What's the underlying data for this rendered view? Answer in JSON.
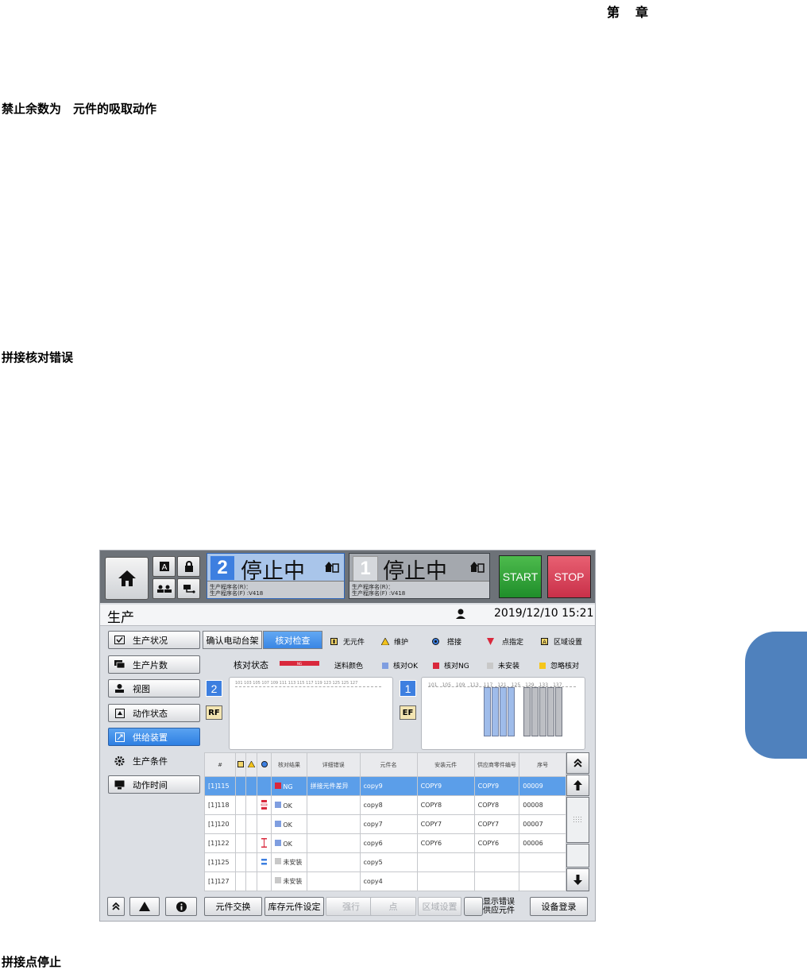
{
  "doc": {
    "chapter": "第　章",
    "heading1": "禁止余数为　元件的吸取动作",
    "heading2": "拼接核对错误",
    "heading3": "拼接点停止"
  },
  "topbar": {
    "lane2": {
      "number": "2",
      "status": "停止中",
      "prog_r": "生产程序名(R)：",
      "prog_f": "生产程序名(F) :V418"
    },
    "lane1": {
      "number": "1",
      "status": "停止中",
      "prog_r": "生产程序名(R)：",
      "prog_f": "生产程序名(F) :V418"
    },
    "start_label": "START",
    "stop_label": "STOP"
  },
  "header": {
    "title": "生产",
    "datetime": "2019/12/10 15:21"
  },
  "sidebar": {
    "items": [
      {
        "label": "生产状况",
        "icon": "checkbox-icon"
      },
      {
        "label": "生产片数",
        "icon": "boards-icon"
      },
      {
        "label": "视图",
        "icon": "view-icon"
      },
      {
        "label": "动作状态",
        "icon": "action-icon"
      },
      {
        "label": "供给装置",
        "icon": "feeder-icon",
        "active": true
      },
      {
        "label": "生产条件",
        "icon": "gear-icon"
      },
      {
        "label": "动作时间",
        "icon": "monitor-icon"
      }
    ]
  },
  "tabs": [
    {
      "label": "确认电动台架"
    },
    {
      "label": "核对检查",
      "active": true
    }
  ],
  "legend_top": {
    "no_part": "无元件",
    "maintenance": "维护",
    "splice": "搭接",
    "point": "点指定",
    "area": "区域设置"
  },
  "legend_second": {
    "verify_state": "核对状态",
    "ng_bar": "NG",
    "feed_color": "送料颜色",
    "ok": "核对OK",
    "ng": "核对NG",
    "not_installed": "未安装",
    "ignore": "忽略核对"
  },
  "colors": {
    "ok": "#7f9ee0",
    "ng": "#d9283c",
    "not_installed": "#c8c8c8",
    "ignore": "#f6c61b",
    "accent": "#3d7fe0"
  },
  "panels": {
    "left": {
      "badge": "2",
      "tag": "RF",
      "scale": "101 103 105 107 109 111 113 115 117 119 123 125 125 127"
    },
    "right": {
      "badge": "1",
      "tag": "EF",
      "scale": "101　105　109　113　117　121　125　129　133　137"
    }
  },
  "table": {
    "headers": [
      "#",
      "核对结果",
      "详细错误",
      "元件名",
      "安装元件",
      "供应商零件编号",
      "序号"
    ],
    "rows": [
      {
        "id": "[1]115",
        "result": "NG",
        "detail": "拼接元件差异",
        "name": "copy9",
        "installed": "COPY9",
        "vendor": "COPY9",
        "serial": "00009"
      },
      {
        "id": "[1]118",
        "result": "OK",
        "detail": "",
        "name": "copy8",
        "installed": "COPY8",
        "vendor": "COPY8",
        "serial": "00008"
      },
      {
        "id": "[1]120",
        "result": "OK",
        "detail": "",
        "name": "copy7",
        "installed": "COPY7",
        "vendor": "COPY7",
        "serial": "00007"
      },
      {
        "id": "[1]122",
        "result": "OK",
        "detail": "",
        "name": "copy6",
        "installed": "COPY6",
        "vendor": "COPY6",
        "serial": "00006"
      },
      {
        "id": "[1]125",
        "result": "未安装",
        "detail": "",
        "name": "copy5",
        "installed": "",
        "vendor": "",
        "serial": ""
      },
      {
        "id": "[1]127",
        "result": "未安装",
        "detail": "",
        "name": "copy4",
        "installed": "",
        "vendor": "",
        "serial": ""
      }
    ]
  },
  "bottom": {
    "exchange": "元件交换",
    "stock": "库存元件设定",
    "force": "强行",
    "point": "点",
    "area": "区域设置",
    "show_error_line1": "显示错误",
    "show_error_line2": "供应元件",
    "register": "设备登录"
  }
}
